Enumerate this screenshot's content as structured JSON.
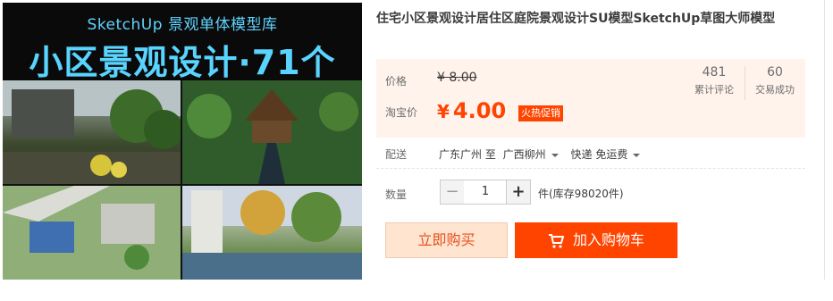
{
  "gallery": {
    "banner_sub": "SketchUp 景观单体模型库",
    "banner_main": "小区景观设计·71个"
  },
  "product": {
    "title": "住宅小区景观设计居住区庭院景观设计SU模型SketchUp草图大师模型"
  },
  "price": {
    "price_label": "价格",
    "original_price": "¥ 8.00",
    "taobao_label": "淘宝价",
    "currency": "¥",
    "current_price": "4.00",
    "promo_badge": "火热促销",
    "reviews_count": "481",
    "reviews_label": "累计评论",
    "deals_count": "60",
    "deals_label": "交易成功"
  },
  "shipping": {
    "label": "配送",
    "from": "广东广州 至",
    "to": "广西柳州",
    "method": "快递 免运费"
  },
  "quantity": {
    "label": "数量",
    "minus": "−",
    "value": "1",
    "plus": "+",
    "stock": "件(库存98020件)"
  },
  "actions": {
    "buy_now": "立即购买",
    "add_to_cart": "加入购物车"
  },
  "colors": {
    "accent": "#ff4400",
    "price_bg": "#fff3ec",
    "buy_bg": "#ffe4d0"
  }
}
